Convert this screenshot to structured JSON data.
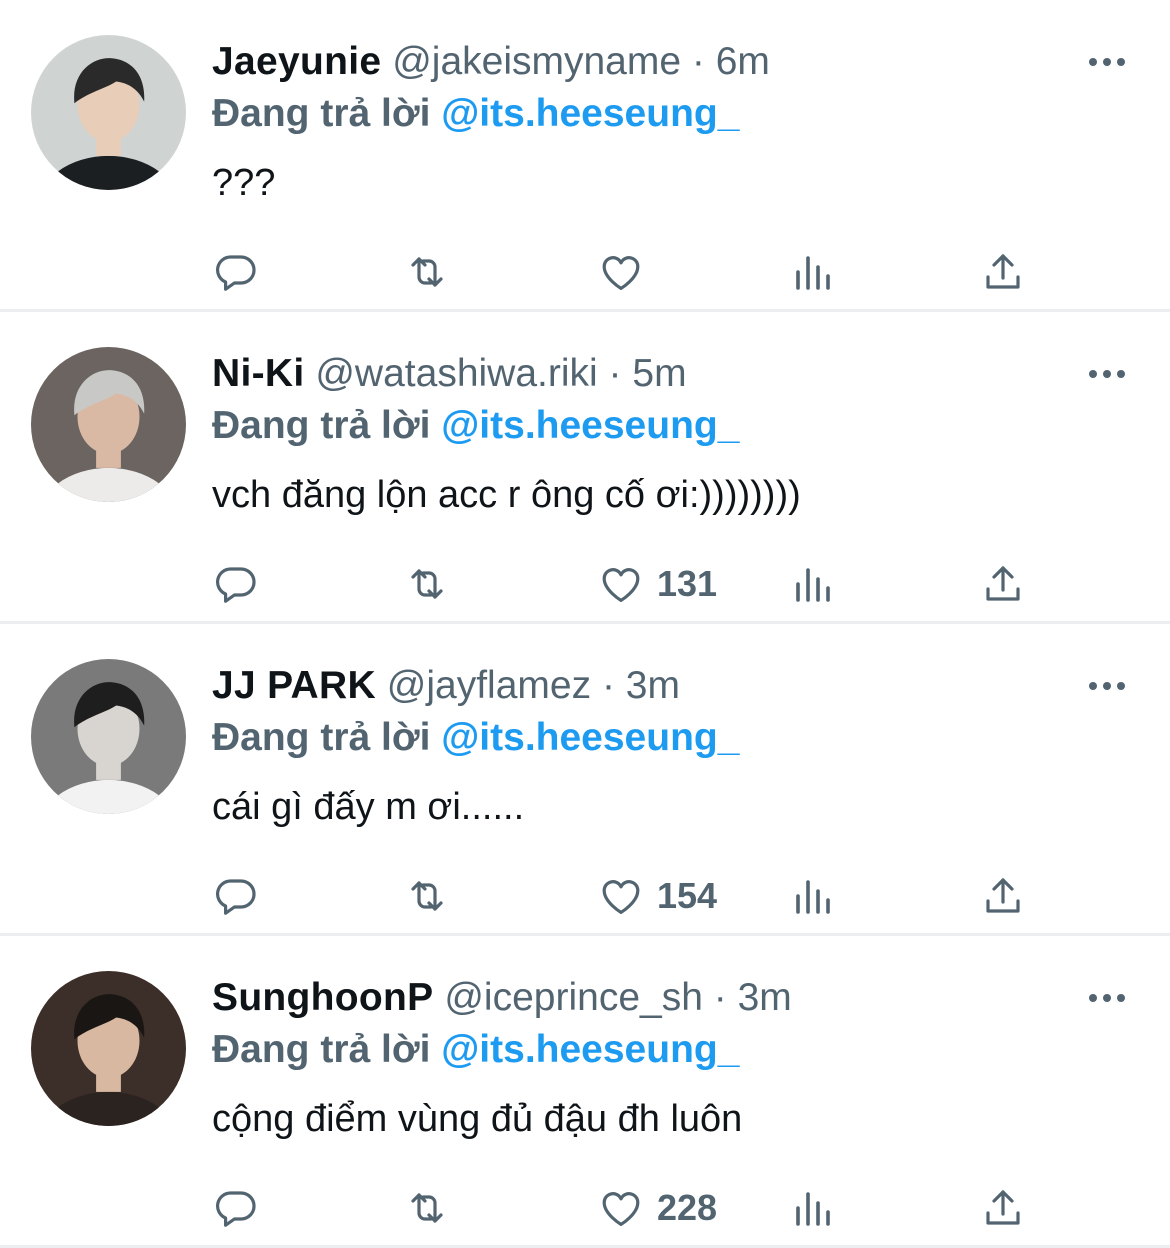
{
  "reply_prefix": "Đang trả lời",
  "tweets": [
    {
      "name": "Jaeyunie",
      "handle": "@jakeismyname",
      "separator": "·",
      "time": "6m",
      "mention": "@its.heeseung_",
      "text": "???",
      "likes": "",
      "avatar_colors": {
        "bg": "#cfd3d2",
        "skin": "#e8cdb8",
        "hair": "#2a2a2a",
        "shirt": "#1c1f22"
      }
    },
    {
      "name": "Ni-Ki",
      "handle": "@watashiwa.riki",
      "separator": "·",
      "time": "5m",
      "mention": "@its.heeseung_",
      "text": "vch đăng lộn acc r ông cố ơi:))))))))",
      "likes": "131",
      "avatar_colors": {
        "bg": "#6b6460",
        "skin": "#d9b9a4",
        "hair": "#c8c8c6",
        "shirt": "#ecebea"
      }
    },
    {
      "name": "JJ PARK",
      "handle": "@jayflamez",
      "separator": "·",
      "time": "3m",
      "mention": "@its.heeseung_",
      "text": "cái gì đấy m ơi......",
      "likes": "154",
      "avatar_colors": {
        "bg": "#7a7a7a",
        "skin": "#d8d4d0",
        "hair": "#1e1e1e",
        "shirt": "#f2f2f2"
      }
    },
    {
      "name": "SunghoonP",
      "handle": "@iceprince_sh",
      "separator": "·",
      "time": "3m",
      "mention": "@its.heeseung_",
      "text": "cộng điểm vùng đủ đậu đh luôn",
      "likes": "228",
      "avatar_colors": {
        "bg": "#3c2e28",
        "skin": "#d9b8a2",
        "hair": "#1a1614",
        "shirt": "#2b2320"
      }
    }
  ],
  "icons": [
    "reply-icon",
    "retweet-icon",
    "like-icon",
    "views-icon",
    "share-icon",
    "more-icon"
  ],
  "colors": {
    "text": "#0f1419",
    "muted": "#536471",
    "accent": "#1d9bf0",
    "divider": "#eceef0"
  }
}
